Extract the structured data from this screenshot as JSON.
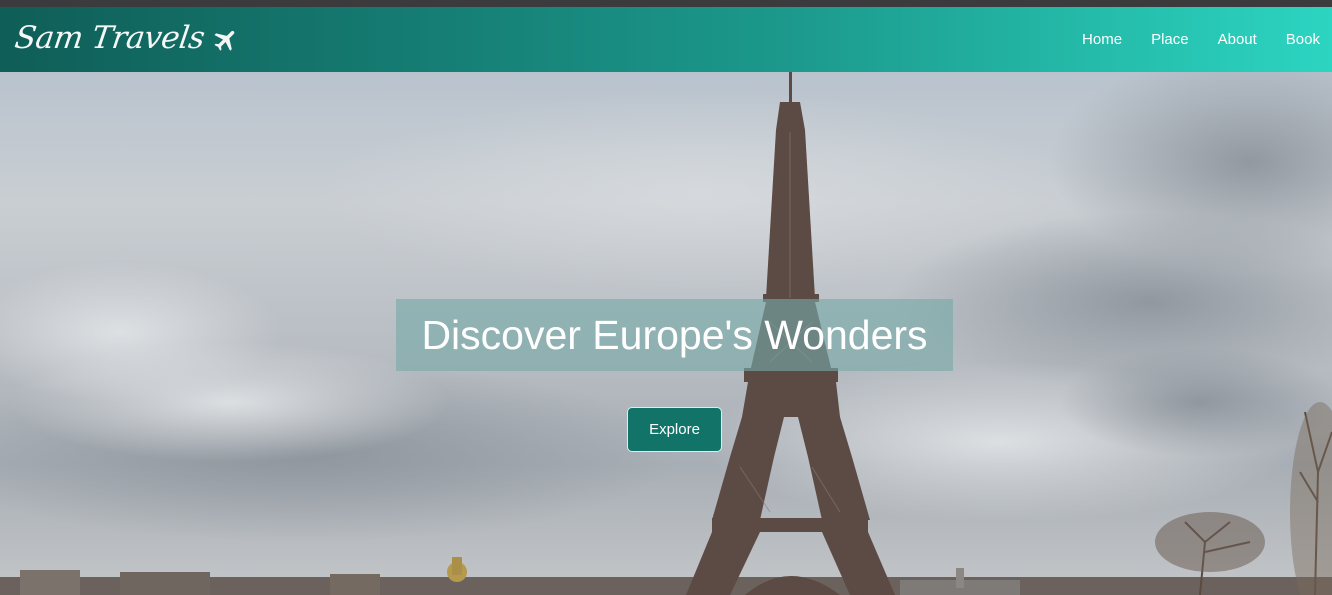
{
  "brand": {
    "name": "Sam Travels",
    "icon": "airplane-icon"
  },
  "nav": {
    "items": [
      {
        "label": "Home"
      },
      {
        "label": "Place"
      },
      {
        "label": "About"
      },
      {
        "label": "Book"
      }
    ]
  },
  "hero": {
    "headline": "Discover Europe's Wonders",
    "cta_label": "Explore",
    "background_image": "eiffel-tower-photo"
  },
  "colors": {
    "nav_start": "#0f5e57",
    "nav_end": "#2cd5c1",
    "button": "#127469"
  }
}
